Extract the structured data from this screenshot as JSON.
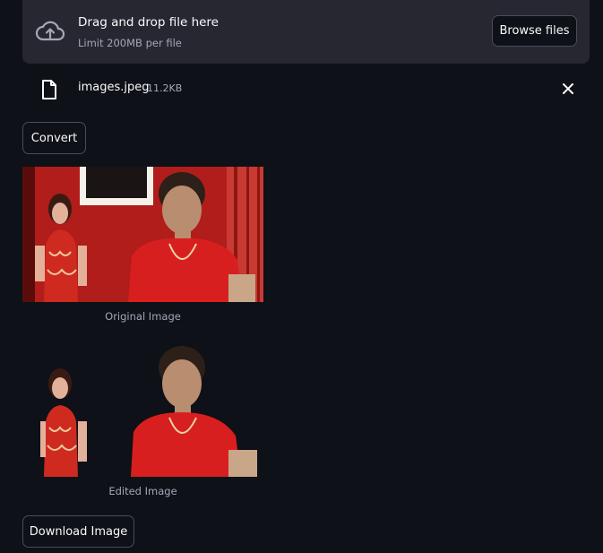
{
  "uploader": {
    "title": "Drag and drop file here",
    "limit": "Limit 200MB per file",
    "browse_label": "Browse files",
    "icon": "cloud-upload-icon"
  },
  "file": {
    "name": "images.jpeg",
    "size": "11.2KB",
    "icon": "file-icon",
    "remove_icon": "close-icon"
  },
  "actions": {
    "convert_label": "Convert",
    "download_label": "Download Image"
  },
  "images": {
    "original_caption": "Original Image",
    "edited_caption": "Edited Image"
  },
  "colors": {
    "background": "#0e1117",
    "surface": "#262730",
    "text": "#fafafa",
    "muted": "#a3a8b8",
    "border": "#4a4c57"
  }
}
